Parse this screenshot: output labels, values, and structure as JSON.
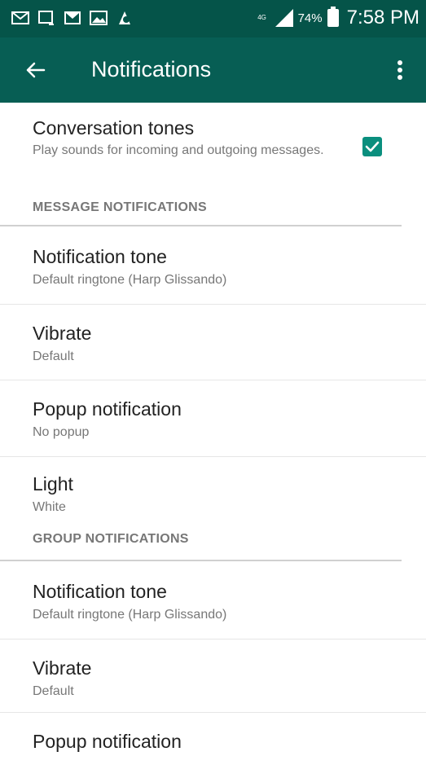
{
  "status_bar": {
    "network": "4G",
    "battery_percent": "74%",
    "time": "7:58 PM"
  },
  "toolbar": {
    "title": "Notifications"
  },
  "conversation_tones": {
    "title": "Conversation tones",
    "subtitle": "Play sounds for incoming and outgoing messages.",
    "checked": true
  },
  "message_notifications": {
    "header": "MESSAGE NOTIFICATIONS",
    "items": [
      {
        "title": "Notification tone",
        "value": "Default ringtone (Harp Glissando)"
      },
      {
        "title": "Vibrate",
        "value": "Default"
      },
      {
        "title": "Popup notification",
        "value": "No popup"
      },
      {
        "title": "Light",
        "value": "White"
      }
    ]
  },
  "group_notifications": {
    "header": "GROUP NOTIFICATIONS",
    "items": [
      {
        "title": "Notification tone",
        "value": "Default ringtone (Harp Glissando)"
      },
      {
        "title": "Vibrate",
        "value": "Default"
      },
      {
        "title": "Popup notification",
        "value": ""
      }
    ]
  },
  "colors": {
    "status_bar": "#055449",
    "toolbar": "#075e54",
    "accent": "#0a8f7e"
  }
}
